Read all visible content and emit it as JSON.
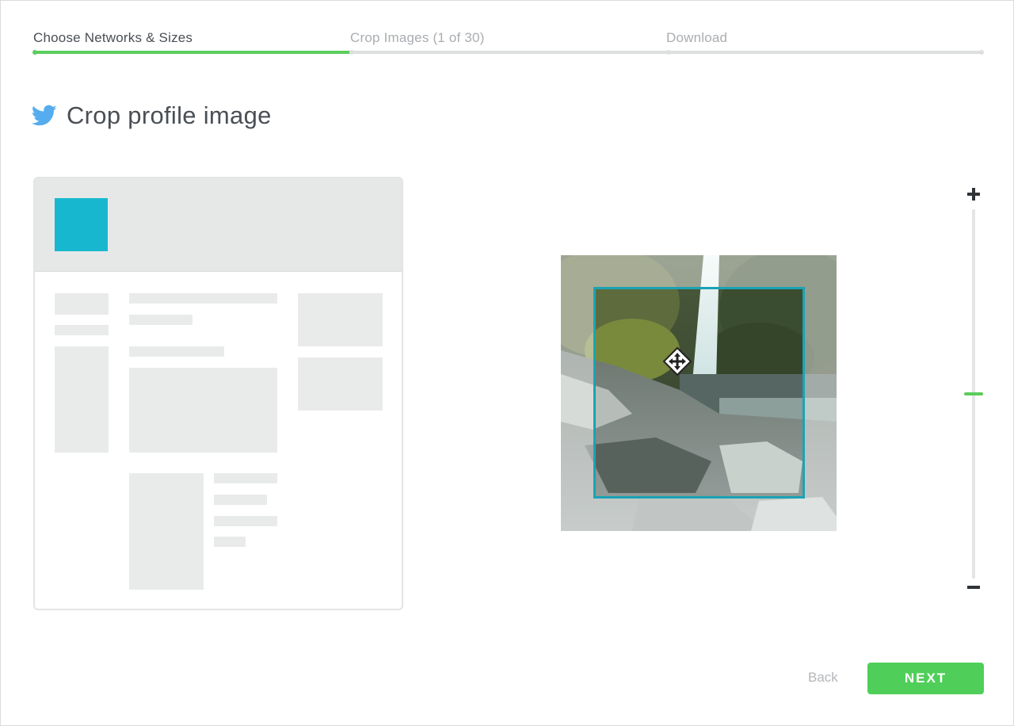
{
  "stepper": {
    "steps": [
      {
        "label": "Choose Networks & Sizes",
        "state": "complete"
      },
      {
        "label": "Crop Images (1 of 30)",
        "state": "upcoming"
      },
      {
        "label": "Download",
        "state": "upcoming"
      }
    ],
    "progress_fraction": 0.333,
    "active_color": "#5ccd5c",
    "inactive_color": "#dedfe0"
  },
  "heading": {
    "icon": "twitter-bird-icon",
    "title": "Crop profile image",
    "icon_color": "#55acee"
  },
  "preview": {
    "avatar_color": "#17b8cf"
  },
  "crop": {
    "frame_color": "#1aa3b5",
    "move_icon": "move-arrows-icon"
  },
  "zoom": {
    "plus_icon": "plus-icon",
    "minus_icon": "minus-icon",
    "level_fraction": 0.5
  },
  "footer": {
    "back_label": "Back",
    "next_label": "NEXT",
    "next_color": "#4fcf59"
  }
}
